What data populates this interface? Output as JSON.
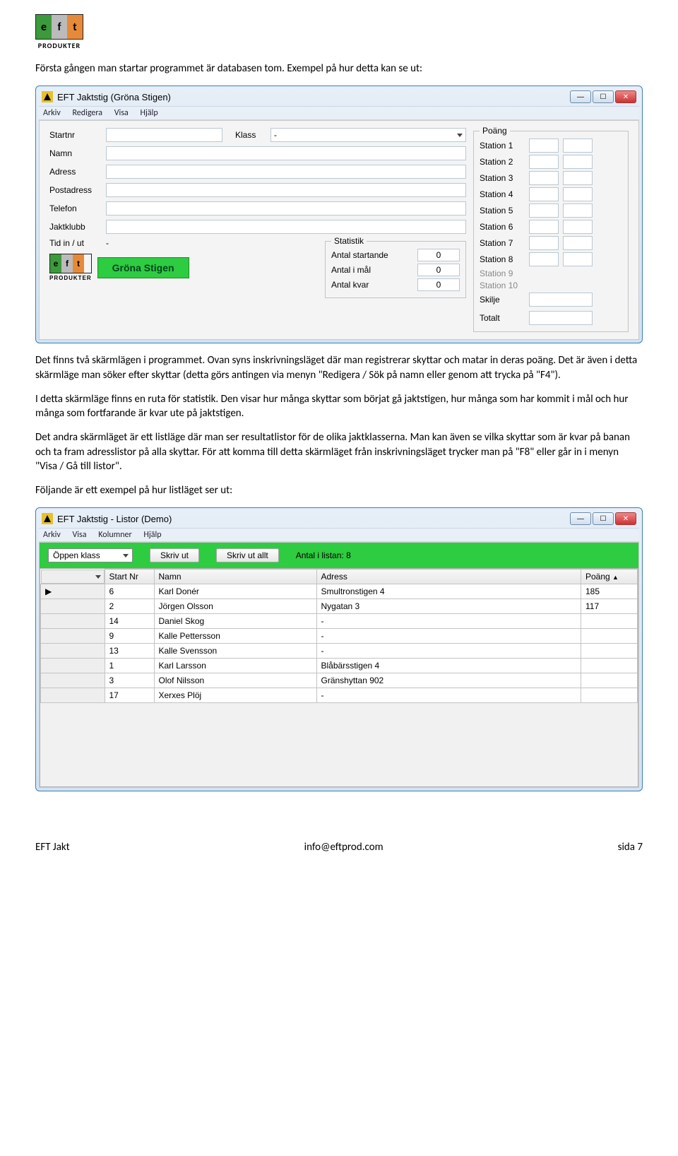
{
  "logo": {
    "e": "e",
    "f": "f",
    "t": "t",
    "sub": "PRODUKTER"
  },
  "para1": "Första gången man startar programmet är databasen tom. Exempel på hur detta kan se ut:",
  "win1": {
    "title": "EFT Jaktstig (Gröna Stigen)",
    "menu": [
      "Arkiv",
      "Redigera",
      "Visa",
      "Hjälp"
    ],
    "labels": {
      "startnr": "Startnr",
      "klass": "Klass",
      "namn": "Namn",
      "adress": "Adress",
      "postadress": "Postadress",
      "telefon": "Telefon",
      "jaktklubb": "Jaktklubb",
      "tid": "Tid in / ut",
      "tidval": "-"
    },
    "klass_value": "-",
    "poang_legend": "Poäng",
    "stations": [
      "Station 1",
      "Station 2",
      "Station 3",
      "Station 4",
      "Station 5",
      "Station 6",
      "Station 7",
      "Station 8",
      "Station 9",
      "Station 10"
    ],
    "skilje": "Skilje",
    "totalt": "Totalt",
    "statistik_legend": "Statistik",
    "stat": {
      "startande_lbl": "Antal startande",
      "startande": "0",
      "imal_lbl": "Antal i mål",
      "imal": "0",
      "kvar_lbl": "Antal kvar",
      "kvar": "0"
    },
    "green_btn": "Gröna Stigen"
  },
  "para2": "Det finns två skärmlägen i programmet. Ovan syns inskrivningsläget där man registrerar skyttar och matar in deras poäng. Det är även i detta skärmläge man söker efter skyttar (detta görs antingen via menyn \"Redigera / Sök på namn eller genom att trycka på \"F4\").",
  "para3": "I detta skärmläge finns en ruta för statistik. Den visar hur många skyttar som börjat gå jaktstigen, hur många som har kommit i mål och hur många som fortfarande är kvar ute på jaktstigen.",
  "para4": "Det andra skärmläget är ett listläge där man ser resultatlistor för de olika jaktklasserna. Man kan även se vilka skyttar som är kvar på banan och ta fram adresslistor på alla skyttar. För att komma till detta skärmläget från inskrivningsläget trycker man på \"F8\" eller går in i menyn \"Visa / Gå till listor\".",
  "para5": "Följande är ett exempel på hur listläget ser ut:",
  "win2": {
    "title": "EFT Jaktstig - Listor (Demo)",
    "menu": [
      "Arkiv",
      "Visa",
      "Kolumner",
      "Hjälp"
    ],
    "dropdown": "Öppen klass",
    "btn_print": "Skriv ut",
    "btn_print_all": "Skriv ut allt",
    "count_label": "Antal i listan: 8",
    "columns": [
      "Start Nr",
      "Namn",
      "Adress",
      "Poäng"
    ],
    "rows": [
      {
        "sel": "▶",
        "start": "6",
        "namn": "Karl Donér",
        "adress": "Smultronstigen 4",
        "poang": "185"
      },
      {
        "sel": "",
        "start": "2",
        "namn": "Jörgen Olsson",
        "adress": "Nygatan 3",
        "poang": "117"
      },
      {
        "sel": "",
        "start": "14",
        "namn": "Daniel Skog",
        "adress": "-",
        "poang": ""
      },
      {
        "sel": "",
        "start": "9",
        "namn": "Kalle Pettersson",
        "adress": "-",
        "poang": ""
      },
      {
        "sel": "",
        "start": "13",
        "namn": "Kalle Svensson",
        "adress": "-",
        "poang": ""
      },
      {
        "sel": "",
        "start": "1",
        "namn": "Karl Larsson",
        "adress": "Blåbärsstigen 4",
        "poang": ""
      },
      {
        "sel": "",
        "start": "3",
        "namn": "Olof Nilsson",
        "adress": "Gränshyttan 902",
        "poang": ""
      },
      {
        "sel": "",
        "start": "17",
        "namn": "Xerxes Plöj",
        "adress": "-",
        "poang": ""
      }
    ]
  },
  "footer": {
    "left": "EFT Jakt",
    "center": "info@eftprod.com",
    "right": "sida 7"
  }
}
